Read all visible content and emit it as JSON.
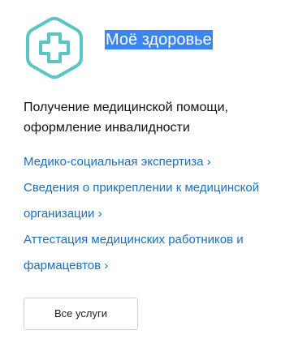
{
  "category": {
    "icon": "medical-cross-icon",
    "accent_color": "#5bc4c4",
    "title": "Моё здоровье",
    "title_highlight_color": "#3a86f1",
    "heading_line1": "Получение медицинской помощи,",
    "heading_line2": "оформление инвалидности",
    "links": [
      {
        "label": "Медико-социальная экспертиза ›"
      },
      {
        "label": "Сведения о прикреплении к медицинской организации ›"
      },
      {
        "label": "Аттестация медицинских работников и фармацевтов ›"
      }
    ],
    "all_services_label": "Все услуги",
    "link_color": "#1a6fb9"
  }
}
